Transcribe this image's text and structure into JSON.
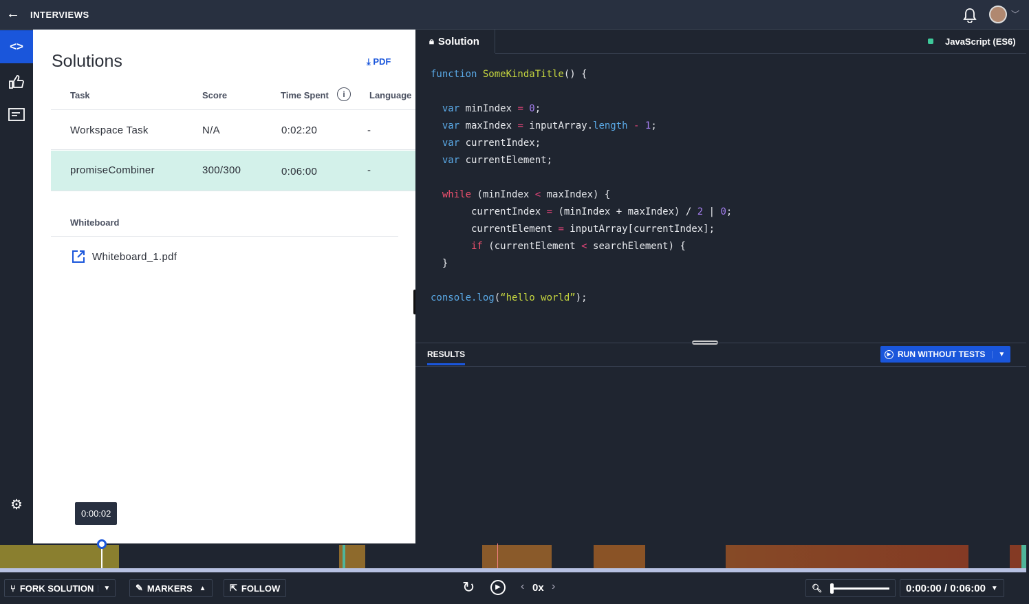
{
  "header": {
    "back_icon": "arrow-left-icon",
    "title": "INTERVIEWS",
    "bell_icon": "bell-icon",
    "avatar": "avatar",
    "chevron": "chevron-down-icon"
  },
  "sidebar": {
    "items": [
      {
        "icon": "code-icon",
        "active": true
      },
      {
        "icon": "thumbs-up-icon"
      },
      {
        "icon": "notes-icon"
      }
    ],
    "settings_icon": "gear-icon"
  },
  "solutions": {
    "title": "Solutions",
    "pdf_label": "PDF",
    "columns": [
      "Task",
      "Score",
      "Time Spent",
      "Language"
    ],
    "rows": [
      {
        "task": "Workspace Task",
        "score": "N/A",
        "time": "0:02:20",
        "language": "-"
      },
      {
        "task": "promiseCombiner",
        "score": "300/300",
        "time": "0:06:00",
        "language": "-",
        "selected": true
      }
    ],
    "whiteboard_header": "Whiteboard",
    "whiteboard_file": "Whiteboard_1.pdf"
  },
  "editor": {
    "tab": "Solution",
    "language": "JavaScript (ES6)",
    "language_status_color": "#3ec99a",
    "lines": [
      [
        [
          "kw",
          "function "
        ],
        [
          "fn",
          "SomeKindaTitle"
        ],
        [
          "",
          "() {"
        ]
      ],
      [],
      [
        [
          "kw",
          "  var "
        ],
        [
          "",
          "minIndex "
        ],
        [
          "op",
          "= "
        ],
        [
          "num",
          "0"
        ],
        [
          "",
          ";"
        ]
      ],
      [
        [
          "kw",
          "  var "
        ],
        [
          "",
          "maxIndex "
        ],
        [
          "op",
          "= "
        ],
        [
          "",
          "inputArray."
        ],
        [
          "kw",
          "length "
        ],
        [
          "op",
          "- "
        ],
        [
          "num",
          "1"
        ],
        [
          "",
          ";"
        ]
      ],
      [
        [
          "kw",
          "  var "
        ],
        [
          "",
          "currentIndex;"
        ]
      ],
      [
        [
          "kw",
          "  var "
        ],
        [
          "",
          "currentElement;"
        ]
      ],
      [],
      [
        [
          "ctl",
          "  while "
        ],
        [
          "",
          "(minIndex "
        ],
        [
          "op",
          "< "
        ],
        [
          "",
          "maxIndex) {"
        ]
      ],
      [
        [
          "",
          "       currentIndex "
        ],
        [
          "op",
          "= "
        ],
        [
          "",
          "(minIndex + maxIndex) / "
        ],
        [
          "num",
          "2 "
        ],
        [
          "",
          "| "
        ],
        [
          "num",
          "0"
        ],
        [
          "",
          ";"
        ]
      ],
      [
        [
          "",
          "       currentElement "
        ],
        [
          "op",
          "= "
        ],
        [
          "",
          "inputArray[currentIndex];"
        ]
      ],
      [
        [
          "ctl",
          "       if "
        ],
        [
          "",
          "(currentElement "
        ],
        [
          "op",
          "< "
        ],
        [
          "",
          "searchElement) {"
        ]
      ],
      [
        [
          "",
          "  }"
        ]
      ],
      [],
      [
        [
          "kw",
          "console.log"
        ],
        [
          "",
          "("
        ],
        [
          "str",
          "“hello world”"
        ],
        [
          "",
          ");"
        ]
      ]
    ]
  },
  "results": {
    "tab": "RESULTS",
    "run_label": "RUN WITHOUT TESTS",
    "accent": "#1a56db"
  },
  "timeline": {
    "tooltip": "0:00:02"
  },
  "controls": {
    "fork": "FORK SOLUTION",
    "markers": "MARKERS",
    "follow": "FOLLOW",
    "speed": "0x",
    "time": "0:00:00 / 0:06:00"
  }
}
